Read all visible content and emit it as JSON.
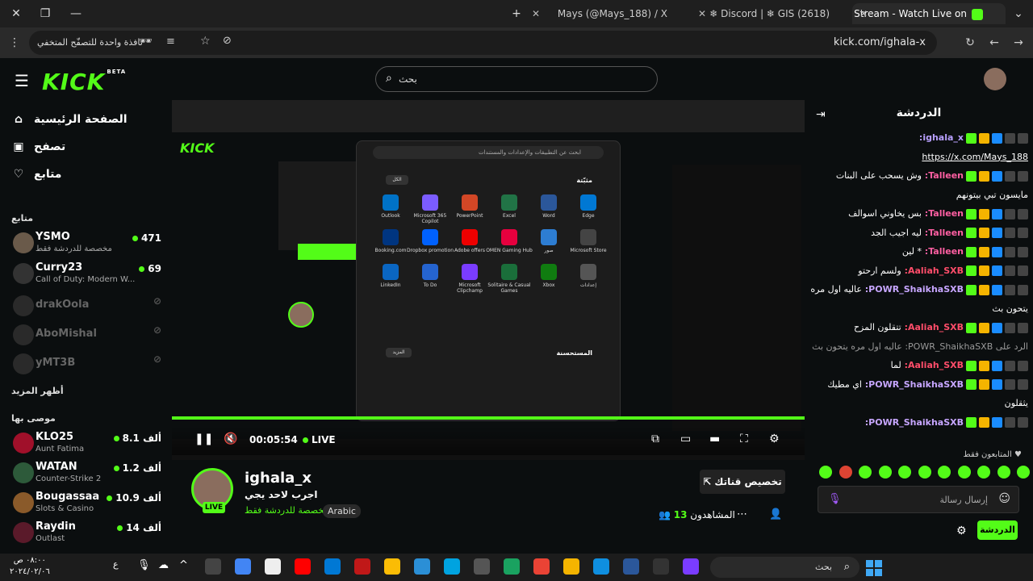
{
  "browser": {
    "tabs": [
      {
        "title": "ighala_x Stream - Watch Live on",
        "color": "#53fc18"
      },
      {
        "title": "(2618) Discord | ❄ GIS ❄",
        "color": "#5865f2"
      },
      {
        "title": "Mays (@Mays_188) / X",
        "color": "#000000"
      }
    ],
    "url": "kick.com/ighala-x",
    "incognito_label": "نافذة واحدة للتصفّح المتخفي"
  },
  "site": {
    "logo": "KICK",
    "logo_badge": "BETA",
    "search_placeholder": "بحث"
  },
  "sidebar": {
    "nav": [
      {
        "label": "الصفحة الرئيسية",
        "icon": "home-icon"
      },
      {
        "label": "تصفح",
        "icon": "browse-icon"
      },
      {
        "label": "متابع",
        "icon": "heart-icon"
      }
    ],
    "following_title": "متابع",
    "following": [
      {
        "name": "YSMO",
        "sub": "مخصصة للدردشة فقط",
        "viewers": "471",
        "live": true
      },
      {
        "name": "Curry23",
        "sub": "Call of Duty: Modern W...",
        "viewers": "69",
        "live": true
      },
      {
        "name": "drakOola",
        "sub": "",
        "viewers": "",
        "live": false
      },
      {
        "name": "AboMishal",
        "sub": "",
        "viewers": "",
        "live": false
      },
      {
        "name": "yMT3B",
        "sub": "",
        "viewers": "",
        "live": false
      }
    ],
    "show_more": "أظهر المزيد",
    "recommended_title": "موصى بها",
    "recommended": [
      {
        "name": "KLO25",
        "sub": "Aunt Fatima",
        "viewers": "8.1 ألف"
      },
      {
        "name": "WATAN",
        "sub": "Counter-Strike 2",
        "viewers": "1.2 ألف"
      },
      {
        "name": "Bougassaa",
        "sub": "Slots & Casino",
        "viewers": "10.9 ألف"
      },
      {
        "name": "Raydin",
        "sub": "Outlast",
        "viewers": "14 ألف"
      }
    ]
  },
  "player": {
    "time": "00:05:54",
    "live_label": "LIVE",
    "start_menu": {
      "search": "ابحث عن التطبيقات والإعدادات والمستندات",
      "pinned_title": "مثبّتة",
      "all_button": "الكل",
      "apps": [
        "Edge",
        "Word",
        "Excel",
        "PowerPoint",
        "Microsoft 365 Copilot",
        "Outlook",
        "Microsoft Store",
        "صور",
        "OMEN Gaming Hub",
        "Adobe offers",
        "Dropbox promotion",
        "Booking.com",
        "إعدادات",
        "Xbox",
        "Solitaire & Casual Games",
        "Microsoft Clipchamp",
        "To Do",
        "LinkedIn"
      ],
      "recommended_title": "المستحسنة",
      "more_button": "المزيد"
    }
  },
  "channel": {
    "name": "ighala_x",
    "title": "اجرب لاحد يجي",
    "category": "مخصصة للدردشة فقط",
    "language": "Arabic",
    "viewers_label": "المشاهدون",
    "viewers": "13",
    "live_badge": "LIVE",
    "customize_button": "تخصيص قناتك"
  },
  "chat": {
    "title": "الدردشة",
    "messages": [
      {
        "user": "ighala_x:",
        "text": "",
        "color": "#b9a0ff"
      },
      {
        "user": "",
        "text": "https://x.com/Mays_188",
        "color": "#ffffff",
        "link": true
      },
      {
        "user": "Talleen:",
        "text": "وش يسحب على البنات",
        "color": "#ff5fa2"
      },
      {
        "user": "",
        "text": "مايسون تبي بيتونهم",
        "color": "#ffffff"
      },
      {
        "user": "Talleen:",
        "text": "بس يخاوني اسوالف",
        "color": "#ff5fa2"
      },
      {
        "user": "Talleen:",
        "text": "ليه اجيب الجد",
        "color": "#ff5fa2"
      },
      {
        "user": "Talleen:",
        "text": "* لين",
        "color": "#ff5fa2"
      },
      {
        "user": "Aaliah_SXB:",
        "text": "ولسم ارحتو",
        "color": "#ff4d6a"
      },
      {
        "user": "POWR_ShaikhaSXB:",
        "text": "عاليه اول مره",
        "color": "#c7a6ff"
      },
      {
        "user": "",
        "text": "يتحون بث",
        "color": "#ffffff"
      },
      {
        "user": "Aaliah_SXB:",
        "text": "تتقلون المزح",
        "color": "#ff4d6a"
      },
      {
        "user": "",
        "text": "الرد على POWR_ShaikhaSXB: عاليه اول مره يتحون بث",
        "color": "#999999"
      },
      {
        "user": "Aaliah_SXB:",
        "text": "لما",
        "color": "#ff4d6a"
      },
      {
        "user": "POWR_ShaikhaSXB:",
        "text": "اي مطيك",
        "color": "#c7a6ff"
      },
      {
        "user": "",
        "text": "يثقلون",
        "color": "#ffffff"
      },
      {
        "user": "POWR_ShaikhaSXB:",
        "text": "",
        "color": "#c7a6ff"
      }
    ],
    "followers_only": "المتابعون فقط",
    "input_placeholder": "إرسال رسالة",
    "send_button": "الدردشة"
  },
  "taskbar": {
    "search": "بحث",
    "time": "٠٨:٠٠ ص",
    "date": "٢٠٢٤/٠٢/٠٦",
    "lang": "ع"
  }
}
